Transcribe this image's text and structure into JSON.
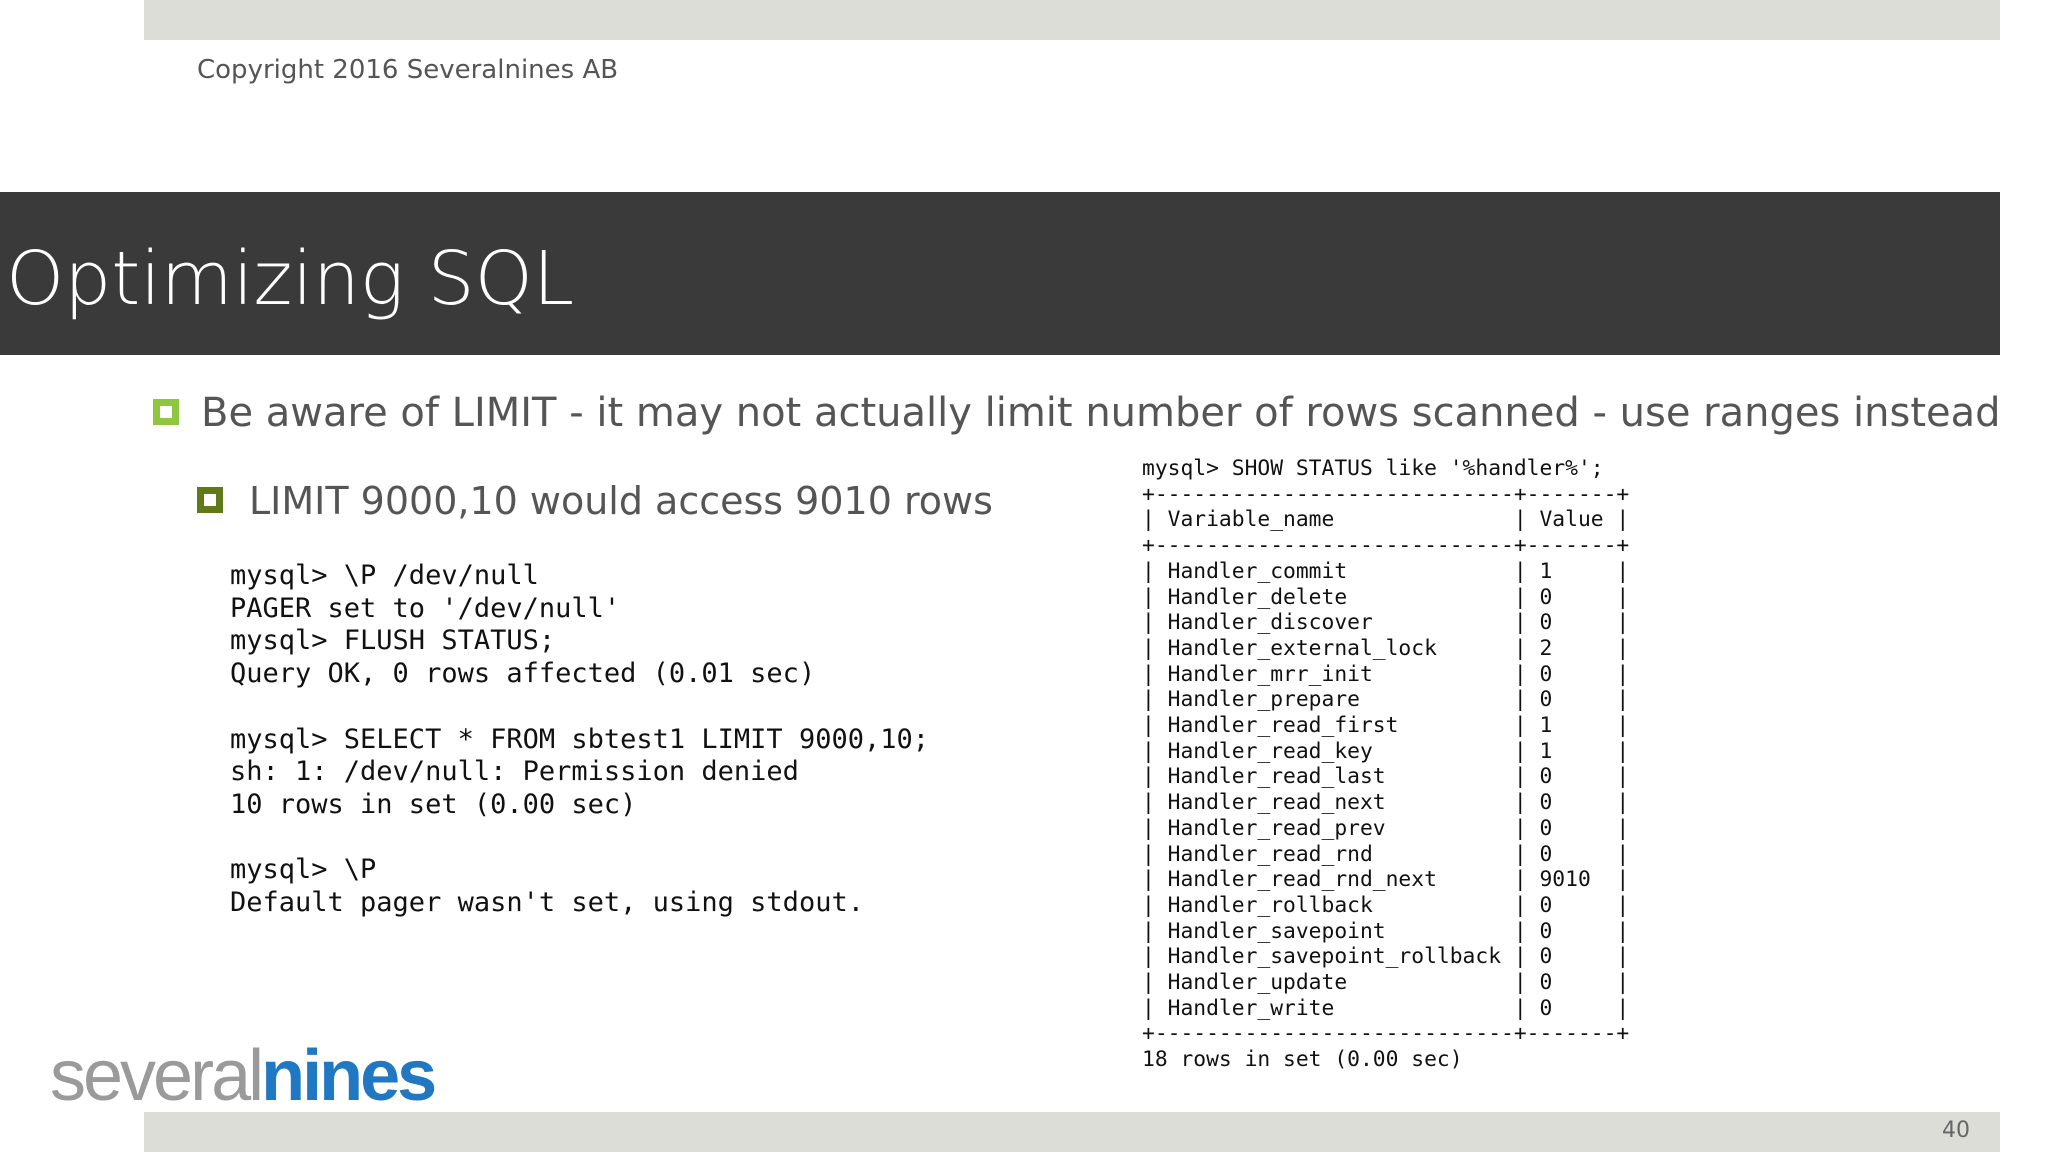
{
  "header": {
    "copyright": "Copyright 2016 Severalnines AB"
  },
  "slide": {
    "title": "Optimizing SQL",
    "bullet1": "Be aware of LIMIT - it may not actually limit number of rows scanned - use ranges instead",
    "bullet2": "LIMIT 9000,10 would access 9010 rows",
    "bullet_colors": {
      "level1": "#8ec63f",
      "level2": "#607a1a"
    }
  },
  "terminal_left": {
    "lines": [
      "mysql> \\P /dev/null",
      "PAGER set to '/dev/null'",
      "mysql> FLUSH STATUS;",
      "Query OK, 0 rows affected (0.01 sec)",
      "",
      "mysql> SELECT * FROM sbtest1 LIMIT 9000,10;",
      "sh: 1: /dev/null: Permission denied",
      "10 rows in set (0.00 sec)",
      "",
      "mysql> \\P",
      "Default pager wasn't set, using stdout."
    ]
  },
  "terminal_right": {
    "command": "mysql> SHOW STATUS like '%handler%';",
    "columns": [
      "Variable_name",
      "Value"
    ],
    "rows": [
      [
        "Handler_commit",
        "1"
      ],
      [
        "Handler_delete",
        "0"
      ],
      [
        "Handler_discover",
        "0"
      ],
      [
        "Handler_external_lock",
        "2"
      ],
      [
        "Handler_mrr_init",
        "0"
      ],
      [
        "Handler_prepare",
        "0"
      ],
      [
        "Handler_read_first",
        "1"
      ],
      [
        "Handler_read_key",
        "1"
      ],
      [
        "Handler_read_last",
        "0"
      ],
      [
        "Handler_read_next",
        "0"
      ],
      [
        "Handler_read_prev",
        "0"
      ],
      [
        "Handler_read_rnd",
        "0"
      ],
      [
        "Handler_read_rnd_next",
        "9010"
      ],
      [
        "Handler_rollback",
        "0"
      ],
      [
        "Handler_savepoint",
        "0"
      ],
      [
        "Handler_savepoint_rollback",
        "0"
      ],
      [
        "Handler_update",
        "0"
      ],
      [
        "Handler_write",
        "0"
      ]
    ],
    "footer": "18 rows in set (0.00 sec)"
  },
  "logo": {
    "part1": "several",
    "part2": "nines",
    "colors": {
      "part1": "#9a9a9a",
      "part2": "#1f78c1"
    }
  },
  "footer": {
    "page_number": "40"
  }
}
